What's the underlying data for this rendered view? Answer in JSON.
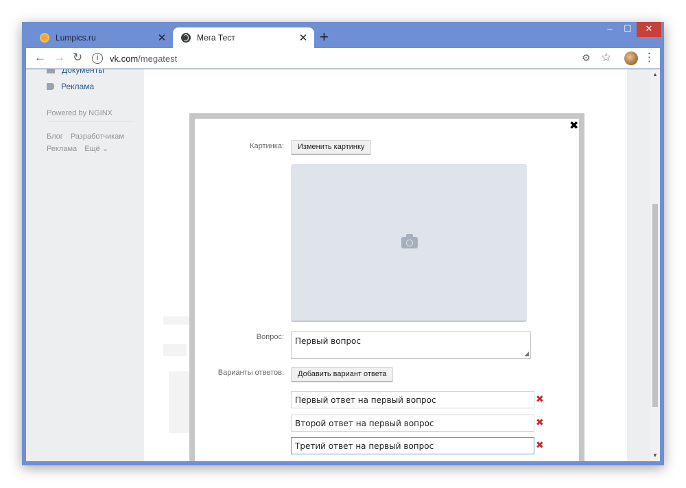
{
  "browser": {
    "tabs": [
      {
        "title": "Lumpics.ru",
        "active": false
      },
      {
        "title": "Мега Тест",
        "active": true
      }
    ],
    "tab_close_glyph": "✕",
    "new_tab_glyph": "+",
    "window_controls": {
      "minimize": "–",
      "maximize": "☐",
      "close": "✕"
    },
    "url": {
      "host": "vk.com",
      "path": "/megatest"
    },
    "colors": {
      "titlebar": "#6f8fd4",
      "close_button": "#c7403a"
    }
  },
  "sidebar": {
    "items": [
      {
        "label": "Документы",
        "icon": "documents-icon"
      },
      {
        "label": "Реклама",
        "icon": "megaphone-icon"
      }
    ],
    "powered": "Powered by NGINX",
    "footer_links_row1": [
      "Блог",
      "Разработчикам"
    ],
    "footer_links_row2": [
      "Реклама",
      "Ещё ⌄"
    ]
  },
  "modal": {
    "close_glyph": "✖",
    "picture_label": "Картинка:",
    "change_picture_button": "Изменить картинку",
    "question_label": "Вопрос:",
    "question_value": "Первый вопрос",
    "answers_label": "Варианты ответов:",
    "add_answer_button": "Добавить вариант ответа",
    "answers": [
      "Первый ответ на первый вопрос",
      "Второй ответ на первый вопрос",
      "Третий ответ на первый вопрос"
    ],
    "delete_glyph": "✖"
  }
}
